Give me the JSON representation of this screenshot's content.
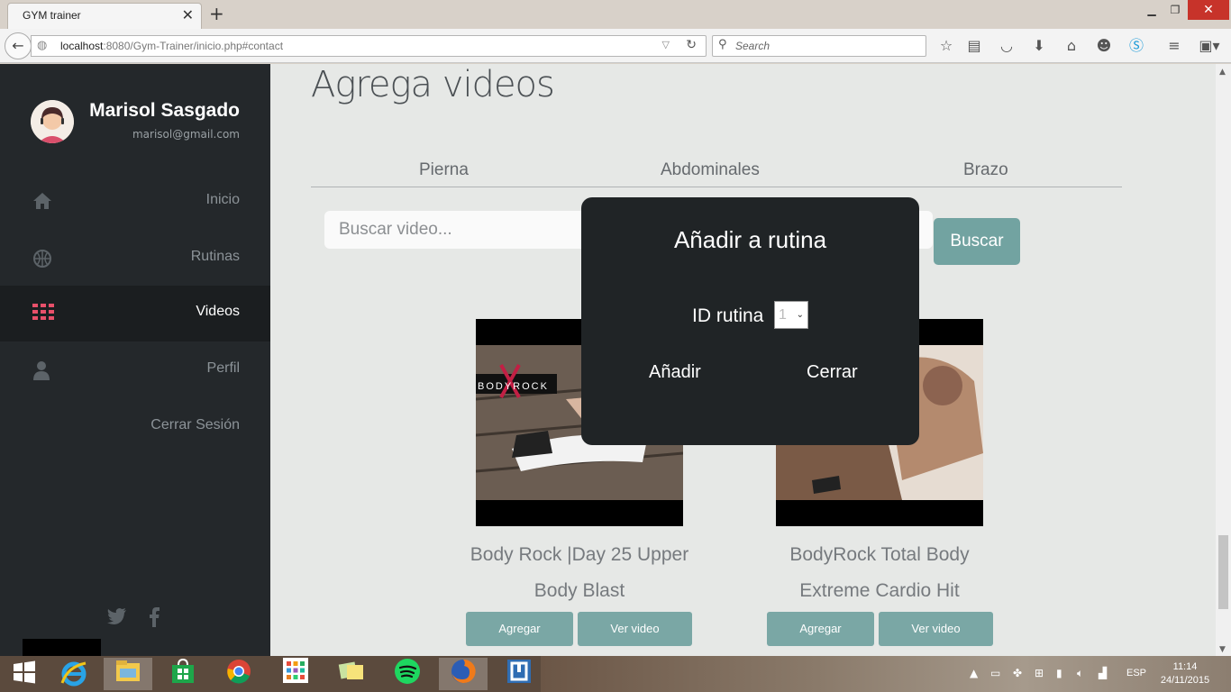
{
  "browser": {
    "tab_title": "GYM trainer",
    "url_host": "localhost",
    "url_rest": ":8080/Gym-Trainer/inicio.php#contact",
    "search_placeholder": "Search"
  },
  "sidebar": {
    "user_name": "Marisol Sasgado",
    "user_email": "marisol@gmail.com",
    "items": [
      {
        "label": "Inicio",
        "icon": "home-icon"
      },
      {
        "label": "Rutinas",
        "icon": "basketball-icon"
      },
      {
        "label": "Videos",
        "icon": "grid-icon",
        "active": true
      },
      {
        "label": "Perfil",
        "icon": "user-icon"
      },
      {
        "label": "Cerrar Sesión",
        "icon": ""
      }
    ]
  },
  "main": {
    "heading": "Agrega videos",
    "tabs": [
      "Pierna",
      "Abdominales",
      "Brazo"
    ],
    "search_placeholder": "Buscar video...",
    "search_button": "Buscar",
    "videos": [
      {
        "title_line1": "Body Rock |Day 25 Upper",
        "title_line2": "Body Blast",
        "add_label": "Agregar",
        "view_label": "Ver video",
        "thumb_text": "BODYROCK"
      },
      {
        "title_line1": "BodyRock Total Body",
        "title_line2": "Extreme Cardio Hit",
        "add_label": "Agregar",
        "view_label": "Ver video"
      }
    ]
  },
  "modal": {
    "title": "Añadir a rutina",
    "id_label": "ID rutina",
    "id_value": "1",
    "add_button": "Añadir",
    "close_button": "Cerrar"
  },
  "taskbar": {
    "lang": "ESP",
    "time": "11:14",
    "date": "24/11/2015"
  },
  "colors": {
    "sidebar": "#24282b",
    "accent": "#72a3a1",
    "modal": "#202426",
    "grid_icon": "#e8506a"
  }
}
